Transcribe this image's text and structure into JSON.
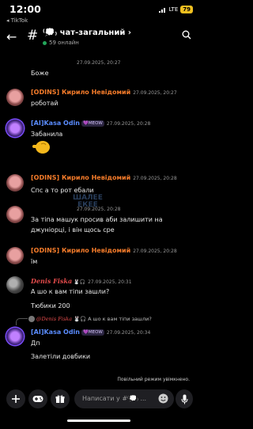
{
  "status_bar": {
    "time": "12:00",
    "back_app": "◂ TikTok",
    "network": "LTE",
    "battery": "79"
  },
  "header": {
    "title": "⁽💭₎ чат-загальний ›",
    "online": "59 онлайн"
  },
  "messages": [
    {
      "ts": "27.09.2025, 20:27",
      "text": "Боже"
    },
    {
      "author": "[ODINS] Кирило Невідомий",
      "ts": "27.09.2025, 20:27",
      "text": "роботай"
    },
    {
      "author": "[AI]Kasa Odin",
      "badge": "💜MEOW",
      "ts": "27.09.2025, 20:28",
      "text": "Забанила"
    },
    {
      "author": "[ODINS] Кирило Невідомий",
      "ts": "27.09.2025, 20:28",
      "text": "Спс а то рот ебали"
    },
    {
      "ts": "27.09.2025, 20:28",
      "text_lines": [
        "За тіпа машук просив аби залишити на",
        "джуніорці, і він щось сре"
      ]
    },
    {
      "author": "[ODINS] Кирило Невідомий",
      "ts": "27.09.2025, 20:28",
      "text": "їм"
    },
    {
      "author": "Denis Fiska",
      "badge": "🐰🎧",
      "ts": "27.09.2025, 20:31",
      "text": "А шо к вам тіпи зашли?"
    },
    {
      "ts": "27.09.2025, 20:31",
      "text": "Тюбики 200"
    },
    {
      "reply": {
        "author": "@Denis Fiska",
        "badge": "🐰🎧",
        "text": "А шо к вам тіпи зашли?"
      },
      "author": "[AI]Kasa Odin",
      "badge": "💜MEOW",
      "ts": "27.09.2025, 20:34",
      "text": "Дп"
    },
    {
      "ts": "27.09.2025, 20:34",
      "text": "Залетіли довбики"
    }
  ],
  "watermark": [
    "ШАЛЕЕ",
    "ЕКЕЕ"
  ],
  "slow_mode": "Повільний режим увімкнено.",
  "composer": {
    "placeholder": "Написати у #⁽💭₎ ..."
  },
  "colors": {
    "author_orange": "#f47b2a",
    "author_blue": "#5a8cff",
    "author_red": "#e24b4b",
    "online": "#23a55a"
  }
}
